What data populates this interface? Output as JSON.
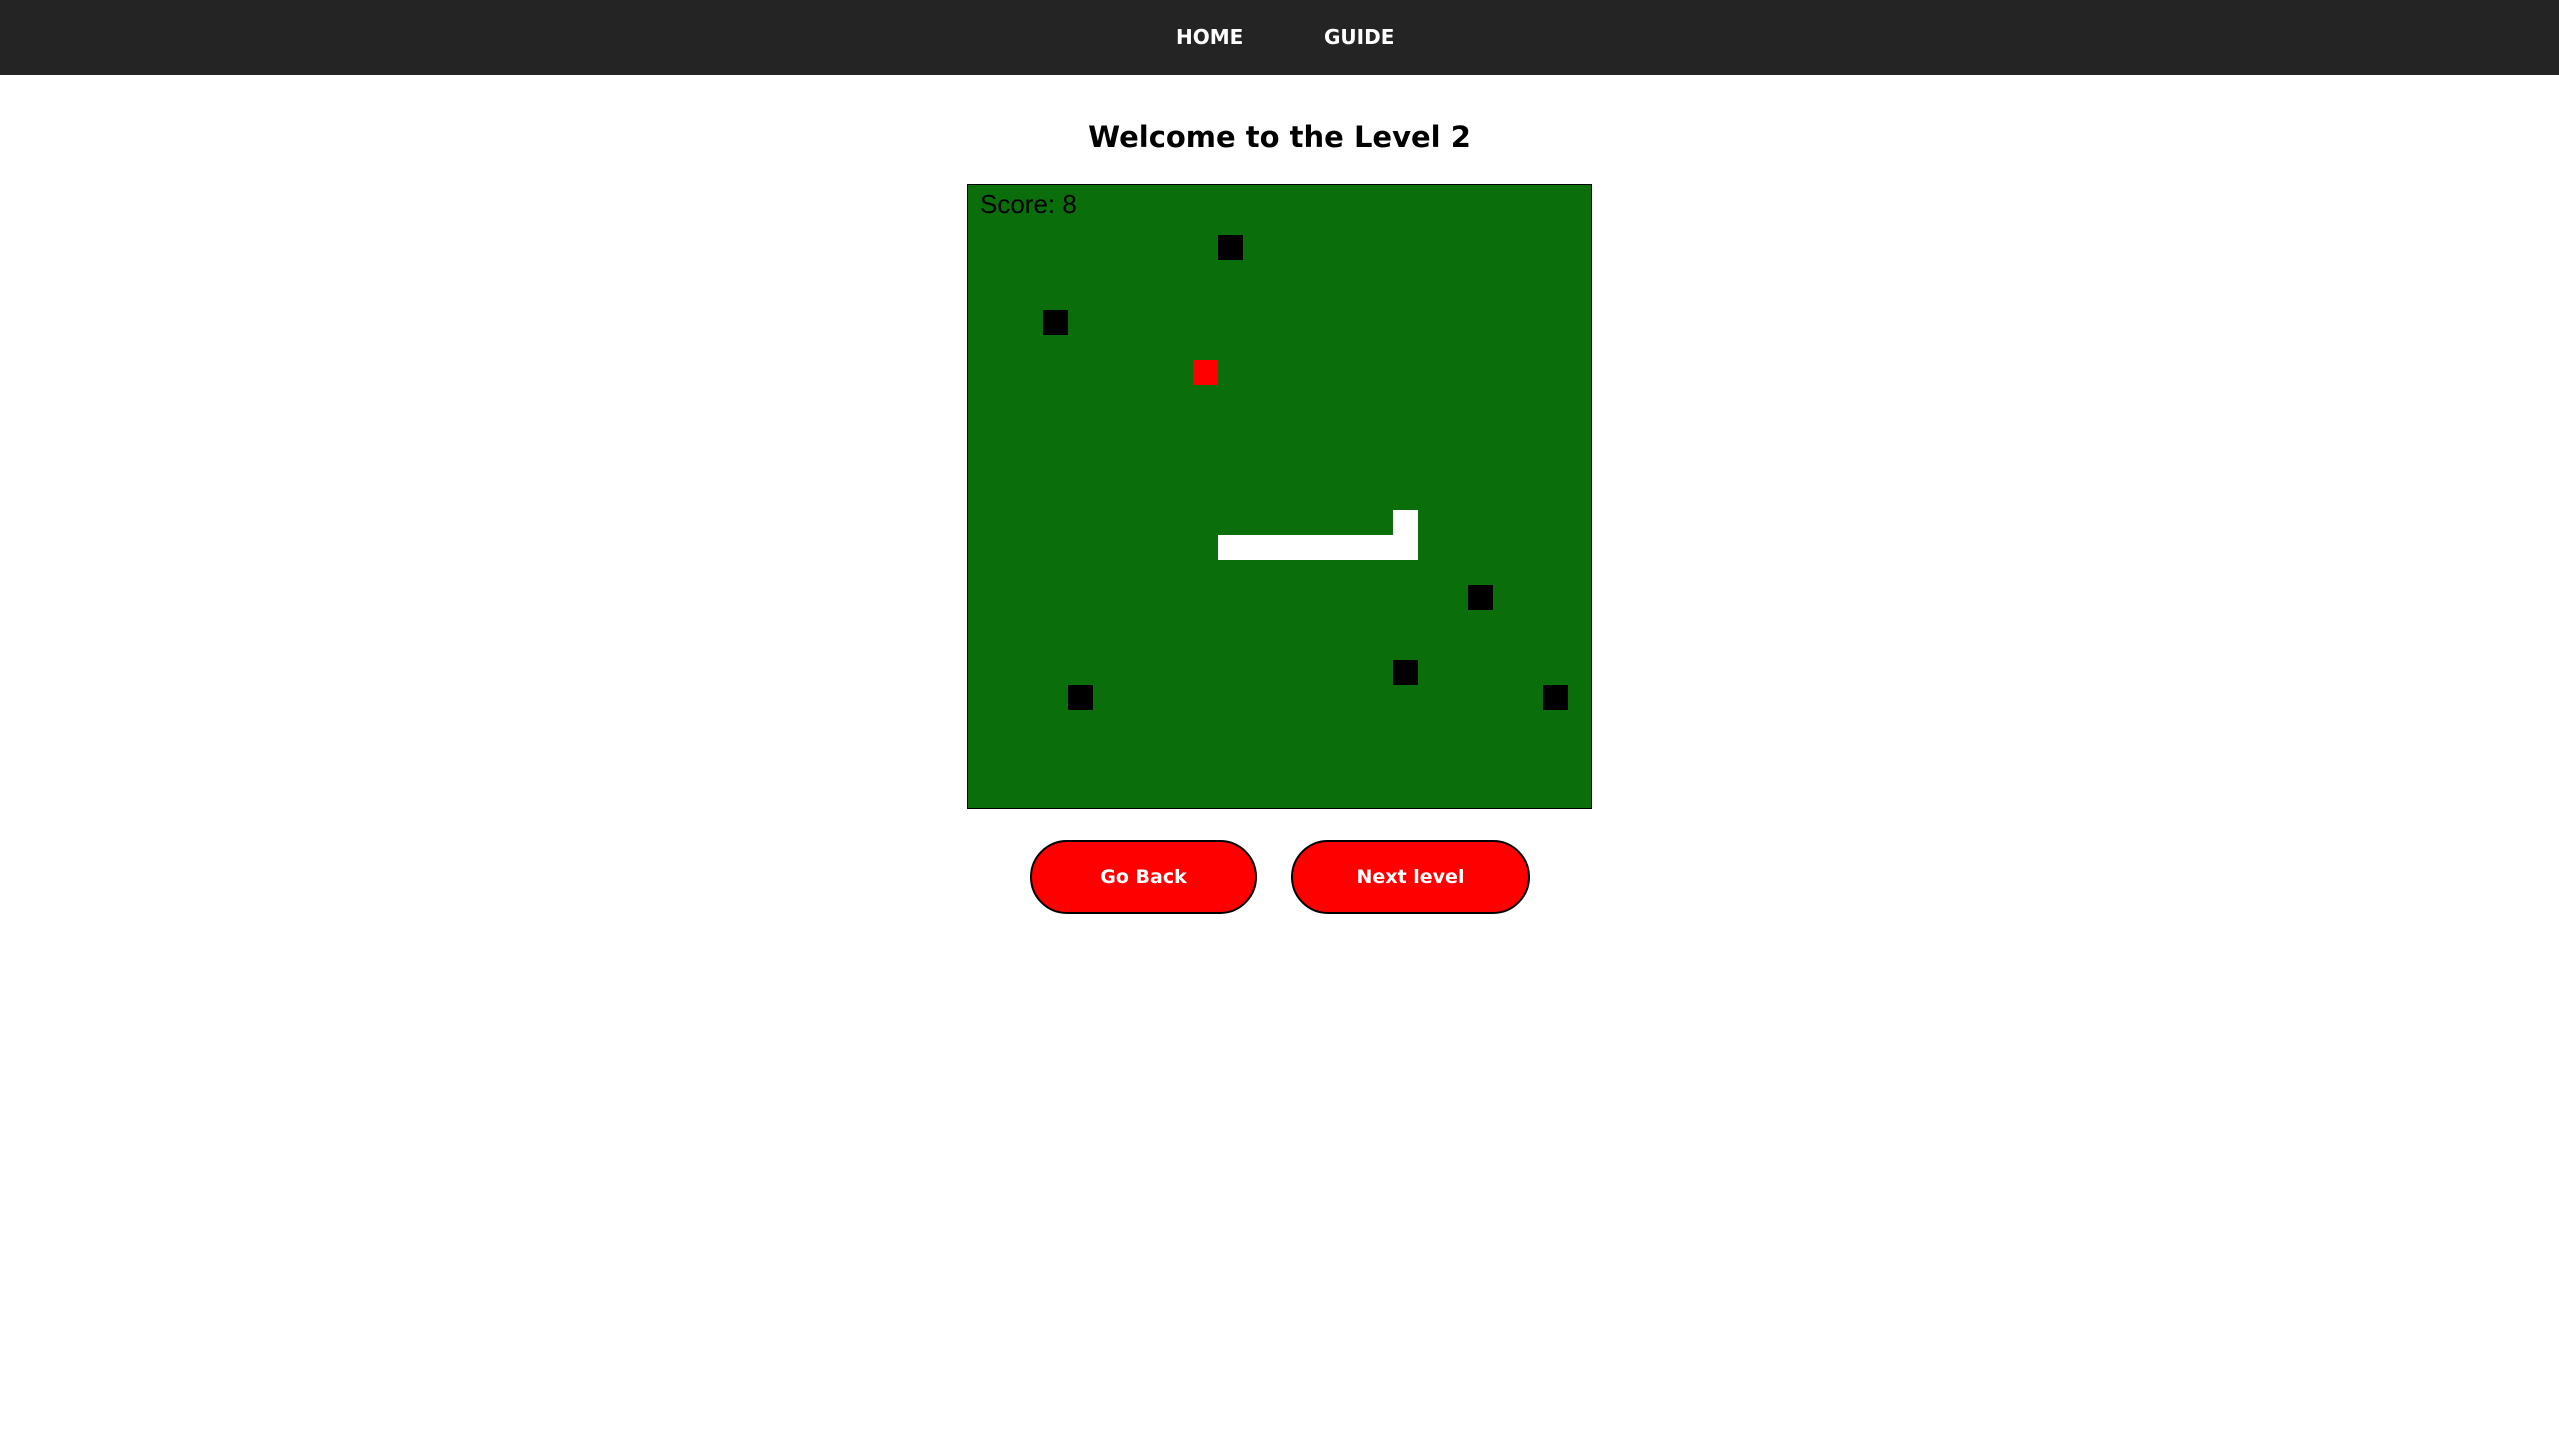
{
  "nav": {
    "home_label": "HOME",
    "guide_label": "GUIDE"
  },
  "page": {
    "title": "Welcome to the Level 2"
  },
  "game": {
    "score_text": "Score: 8",
    "grid_size": 25,
    "colors": {
      "board": "#0a6e0a",
      "snake": "#ffffff",
      "food": "#ff0000",
      "obstacle": "#000000"
    },
    "snake": [
      [
        10,
        14
      ],
      [
        11,
        14
      ],
      [
        12,
        14
      ],
      [
        13,
        14
      ],
      [
        14,
        14
      ],
      [
        15,
        14
      ],
      [
        16,
        14
      ],
      [
        17,
        14
      ],
      [
        17,
        13
      ]
    ],
    "food": [
      9,
      7
    ],
    "obstacles": [
      [
        10,
        2
      ],
      [
        3,
        5
      ],
      [
        20,
        16
      ],
      [
        17,
        19
      ],
      [
        4,
        20
      ],
      [
        23,
        20
      ]
    ]
  },
  "buttons": {
    "back_label": "Go Back",
    "next_label": "Next level"
  }
}
